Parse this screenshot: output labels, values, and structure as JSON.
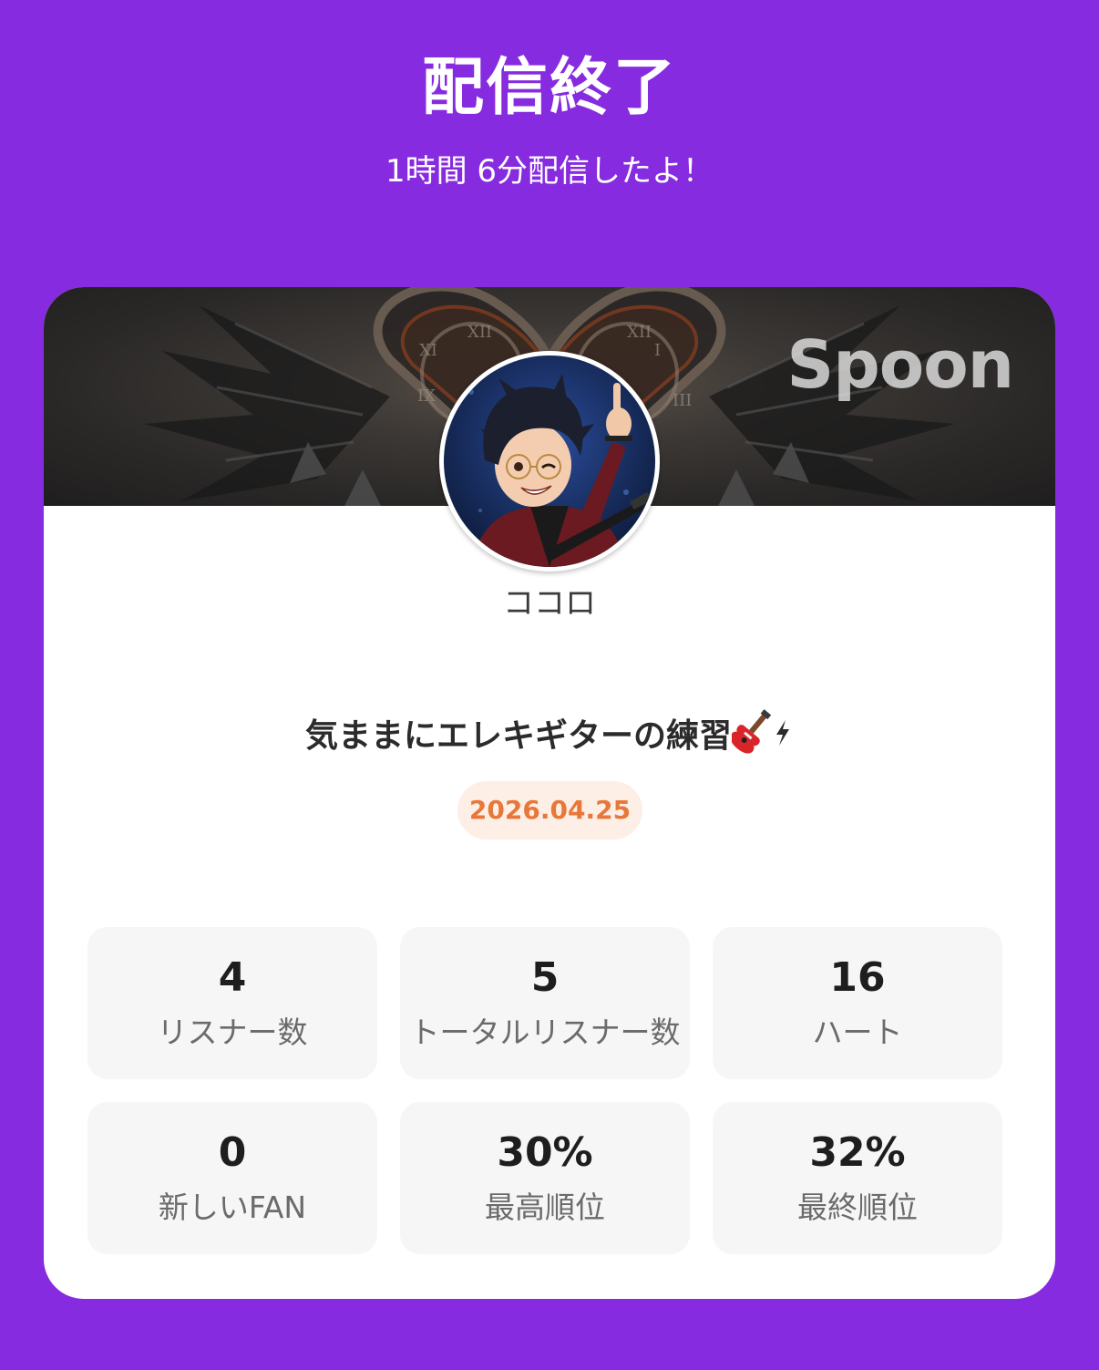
{
  "header": {
    "title": "配信終了",
    "subtitle": "1時間 6分配信したよ！"
  },
  "card": {
    "brand_logo": "Spoon",
    "username": "ココロ",
    "stream_title": "気ままにエレキギターの練習",
    "title_icons": [
      "guitar-icon",
      "lightning-icon"
    ],
    "date": "2026.04.25",
    "stats": [
      {
        "value": "4",
        "label": "リスナー数"
      },
      {
        "value": "5",
        "label": "トータルリスナー数"
      },
      {
        "value": "16",
        "label": "ハート"
      },
      {
        "value": "0",
        "label": "新しいFAN"
      },
      {
        "value": "30%",
        "label": "最高順位"
      },
      {
        "value": "32%",
        "label": "最終順位"
      }
    ]
  },
  "colors": {
    "background": "#862bdf",
    "card": "#ffffff",
    "date_text": "#e8773a",
    "date_badge": "#fdeee6",
    "stat_tile": "#f6f6f6"
  }
}
